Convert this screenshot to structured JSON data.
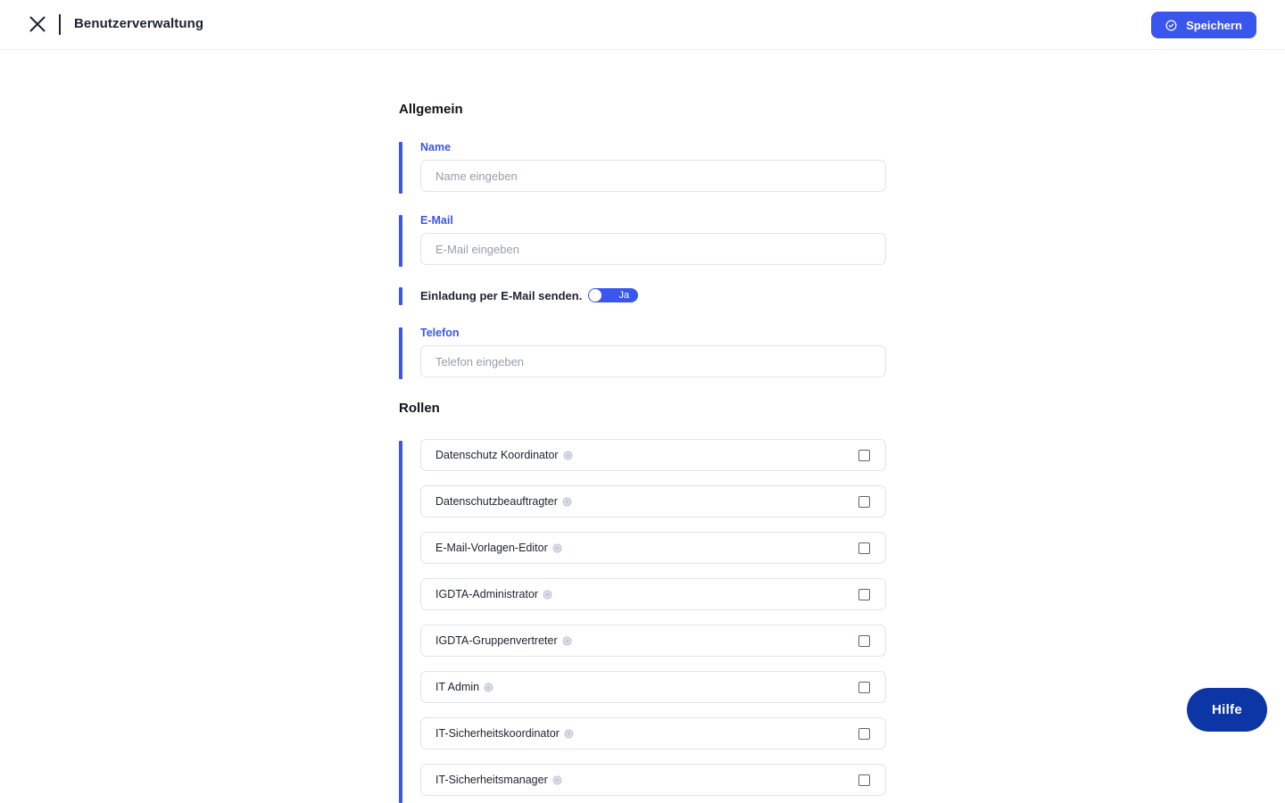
{
  "header": {
    "title": "Benutzerverwaltung",
    "save_label": "Speichern"
  },
  "sections": {
    "general_title": "Allgemein",
    "roles_title": "Rollen"
  },
  "fields": {
    "name": {
      "label": "Name",
      "placeholder": "Name eingeben",
      "value": ""
    },
    "email": {
      "label": "E-Mail",
      "placeholder": "E-Mail eingeben",
      "value": ""
    },
    "invite": {
      "label": "Einladung per E-Mail senden.",
      "toggle_text": "Ja",
      "enabled": true
    },
    "phone": {
      "label": "Telefon",
      "placeholder": "Telefon eingeben",
      "value": ""
    }
  },
  "roles": [
    {
      "name": "Datenschutz Koordinator",
      "checked": false
    },
    {
      "name": "Datenschutzbeauftragter",
      "checked": false
    },
    {
      "name": "E-Mail-Vorlagen-Editor",
      "checked": false
    },
    {
      "name": "IGDTA-Administrator",
      "checked": false
    },
    {
      "name": "IGDTA-Gruppenvertreter",
      "checked": false
    },
    {
      "name": "IT Admin",
      "checked": false
    },
    {
      "name": "IT-Sicherheitskoordinator",
      "checked": false
    },
    {
      "name": "IT-Sicherheitsmanager",
      "checked": false
    }
  ],
  "help": {
    "label": "Hilfe"
  },
  "icons": {
    "close": "close-icon",
    "save": "check-circle-icon",
    "role_info": "info-icon"
  },
  "colors": {
    "accent": "#3a56ef",
    "help_button": "#0c35a6",
    "border": "#e3e4ea",
    "placeholder": "#9a9cab"
  }
}
